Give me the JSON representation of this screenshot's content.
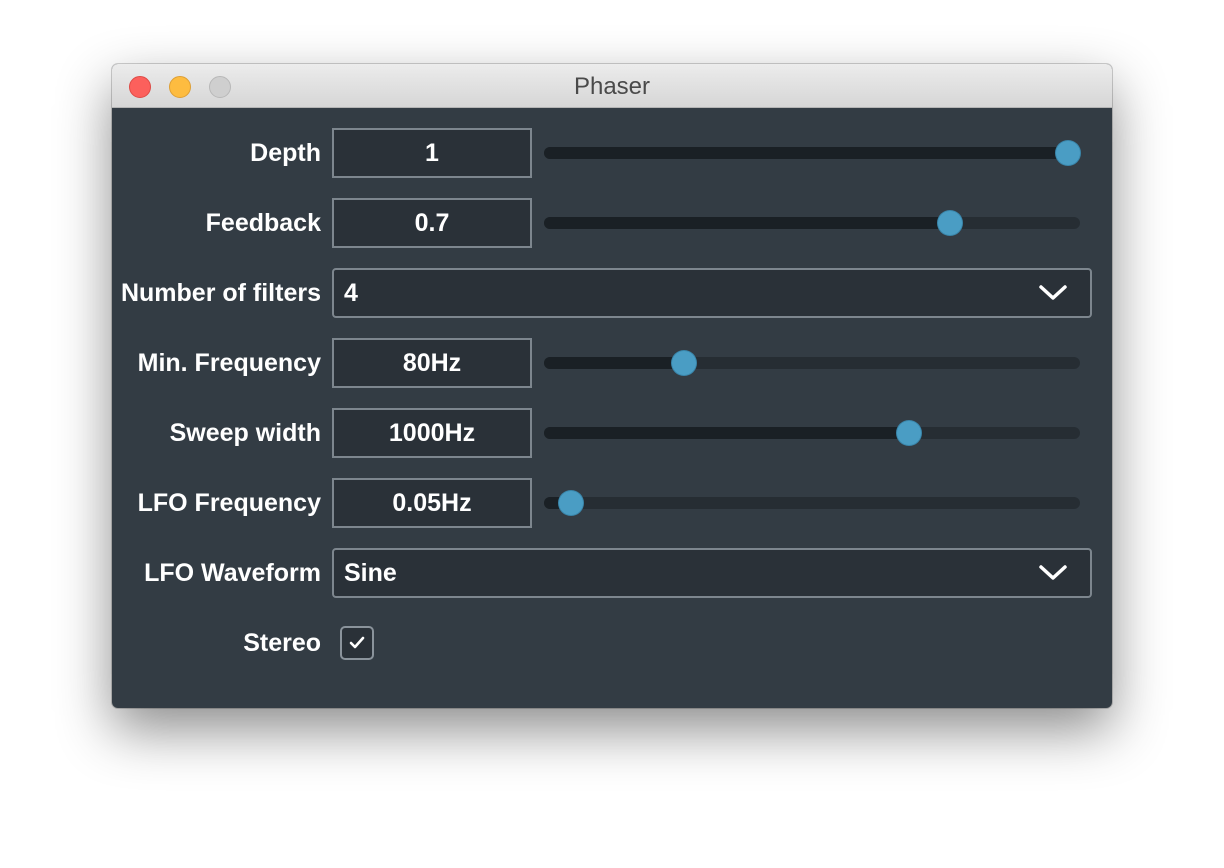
{
  "window": {
    "title": "Phaser"
  },
  "controls": {
    "depth": {
      "label": "Depth",
      "value": "1",
      "level": 1.0
    },
    "feedback": {
      "label": "Feedback",
      "value": "0.7",
      "level": 0.77
    },
    "filters": {
      "label": "Number of filters",
      "selected": "4"
    },
    "min_frequency": {
      "label": "Min. Frequency",
      "value": "80Hz",
      "level": 0.25
    },
    "sweep_width": {
      "label": "Sweep width",
      "value": "1000Hz",
      "level": 0.69
    },
    "lfo_frequency": {
      "label": "LFO Frequency",
      "value": "0.05Hz",
      "level": 0.03
    },
    "lfo_waveform": {
      "label": "LFO Waveform",
      "selected": "Sine"
    },
    "stereo": {
      "label": "Stereo",
      "checked": true
    }
  },
  "colors": {
    "background": "#333c44",
    "accent": "#4a9dc4",
    "field_border": "#7d868e"
  },
  "icons": [
    "chevron-down-icon",
    "checkmark-icon"
  ]
}
